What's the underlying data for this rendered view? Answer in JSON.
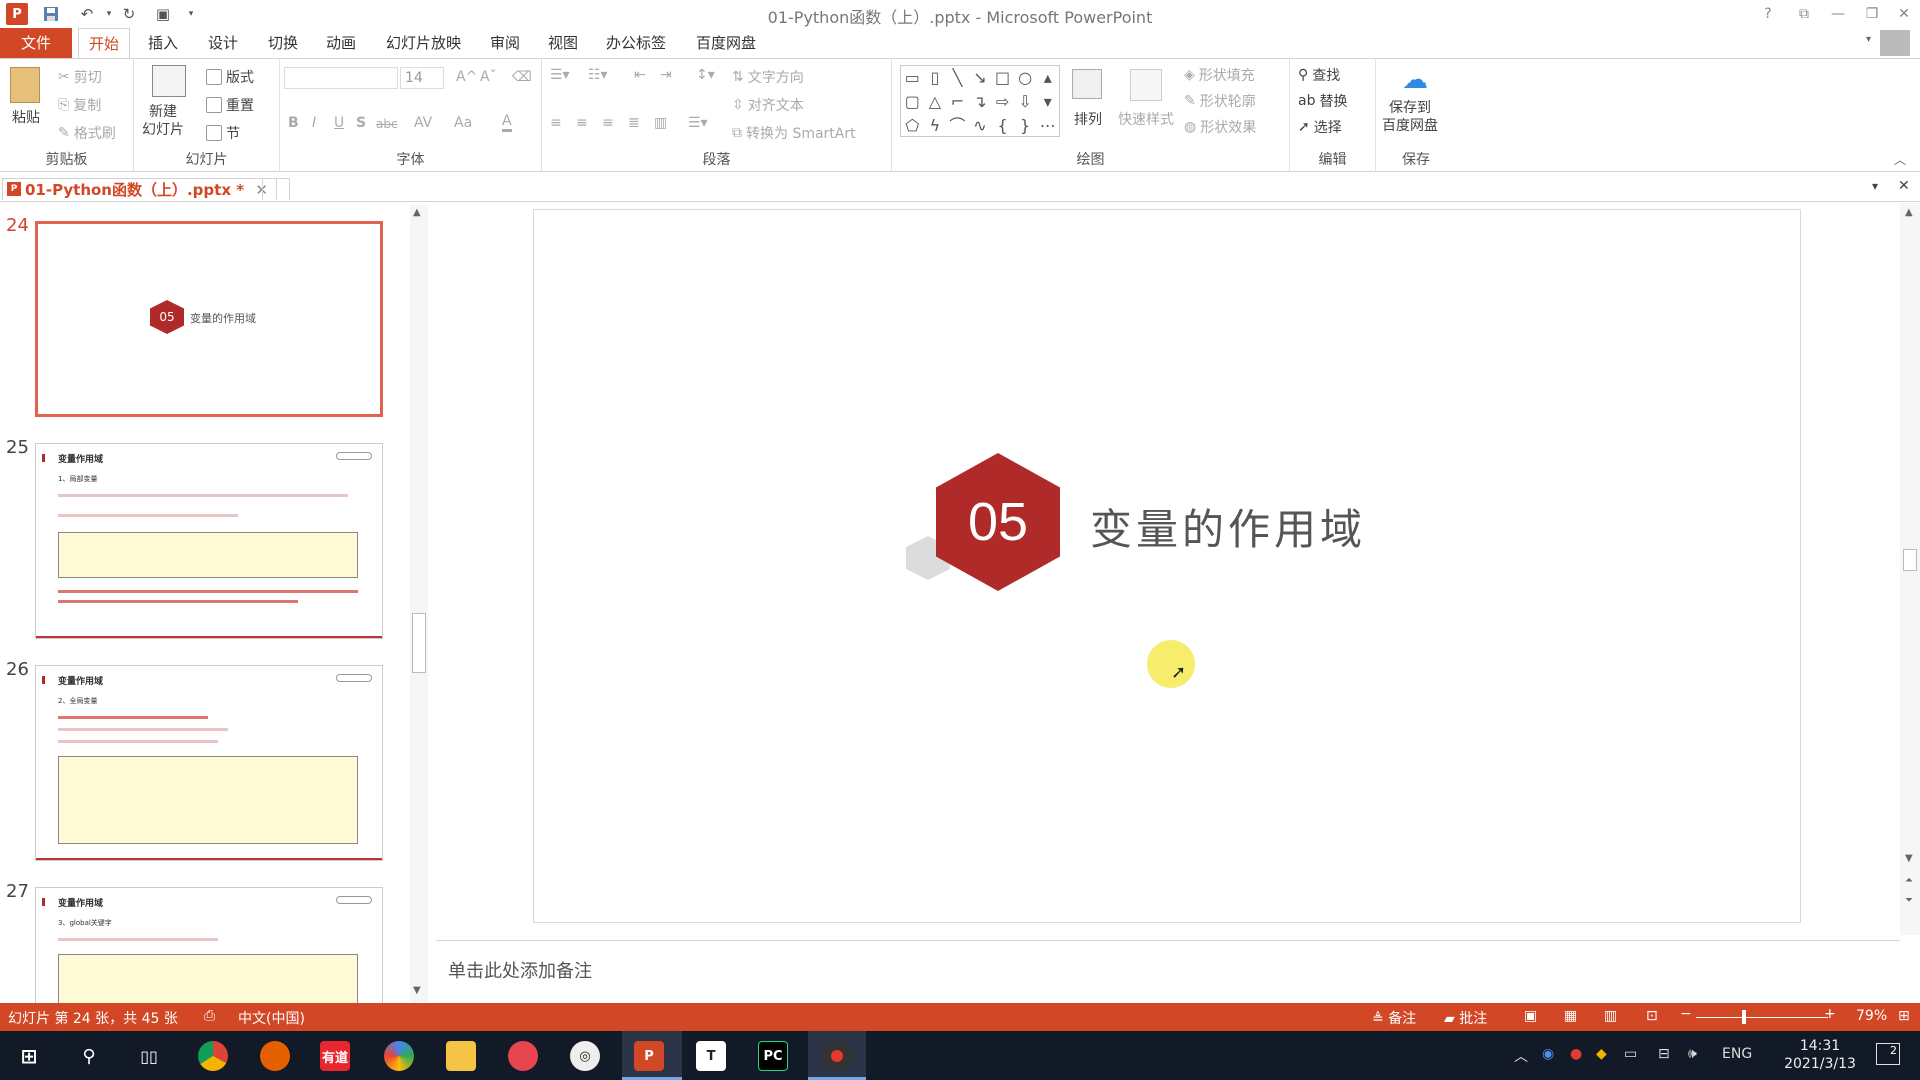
{
  "app": {
    "window_title": "01-Python函数（上）.pptx - Microsoft PowerPoint",
    "help": "?"
  },
  "tabs": [
    "文件",
    "开始",
    "插入",
    "设计",
    "切换",
    "动画",
    "幻灯片放映",
    "审阅",
    "视图",
    "办公标签",
    "百度网盘"
  ],
  "ribbon": {
    "clipboard": {
      "paste": "粘贴",
      "cut": "剪切",
      "copy": "复制",
      "format_painter": "格式刷",
      "label": "剪贴板"
    },
    "slides": {
      "new_slide": "新建\n幻灯片",
      "layout": "版式",
      "reset": "重置",
      "section": "节",
      "label": "幻灯片"
    },
    "font": {
      "size": "14",
      "bold": "B",
      "italic": "I",
      "underline": "U",
      "shadow": "S",
      "strike": "abc",
      "spacing": "AV",
      "case": "Aa",
      "color": "A",
      "label": "字体"
    },
    "paragraph": {
      "text_direction": "文字方向",
      "align_text": "对齐文本",
      "smartart": "转换为 SmartArt",
      "label": "段落"
    },
    "drawing": {
      "arrange": "排列",
      "quick_styles": "快速样式",
      "shape_fill": "形状填充",
      "shape_outline": "形状轮廓",
      "shape_effects": "形状效果",
      "label": "绘图"
    },
    "editing": {
      "find": "查找",
      "replace": "替换",
      "select": "选择",
      "label": "编辑"
    },
    "save": {
      "save_baidu": "保存到\n百度网盘",
      "label": "保存"
    }
  },
  "doc_tab": {
    "name": "01-Python函数（上）.pptx *"
  },
  "thumbnails": [
    {
      "number": "24",
      "selected": true,
      "badge": "05",
      "title": "变量的作用域"
    },
    {
      "number": "25",
      "title": "变量作用域",
      "subtitle": "1、局部变量"
    },
    {
      "number": "26",
      "title": "变量作用域",
      "subtitle": "2、全局变量"
    },
    {
      "number": "27",
      "title": "变量作用域",
      "subtitle": "3、global关键字"
    }
  ],
  "slide": {
    "number_badge": "05",
    "heading": "变量的作用域"
  },
  "notes": {
    "placeholder": "单击此处添加备注"
  },
  "status": {
    "slide_info": "幻灯片 第 24 张，共 45 张",
    "language": "中文(中国)",
    "notes_btn": "备注",
    "comments_btn": "批注",
    "zoom": "79%"
  },
  "taskbar": {
    "apps": [
      "chrome-icon",
      "firefox-icon",
      "youdao-icon",
      "browser-icon",
      "explorer-icon",
      "screenrec-icon",
      "obs-icon",
      "powerpoint-icon",
      "typora-icon",
      "pycharm-icon",
      "recorder-icon"
    ],
    "youdao_label": "有道",
    "powerpoint_label": "P",
    "typora_label": "T",
    "pycharm_label": "PC",
    "ime": "ENG",
    "time": "14:31",
    "date": "2021/3/13",
    "notif_count": "2"
  },
  "colors": {
    "accent": "#d24726",
    "badge": "#b02a2a",
    "taskbar": "#121a27"
  }
}
